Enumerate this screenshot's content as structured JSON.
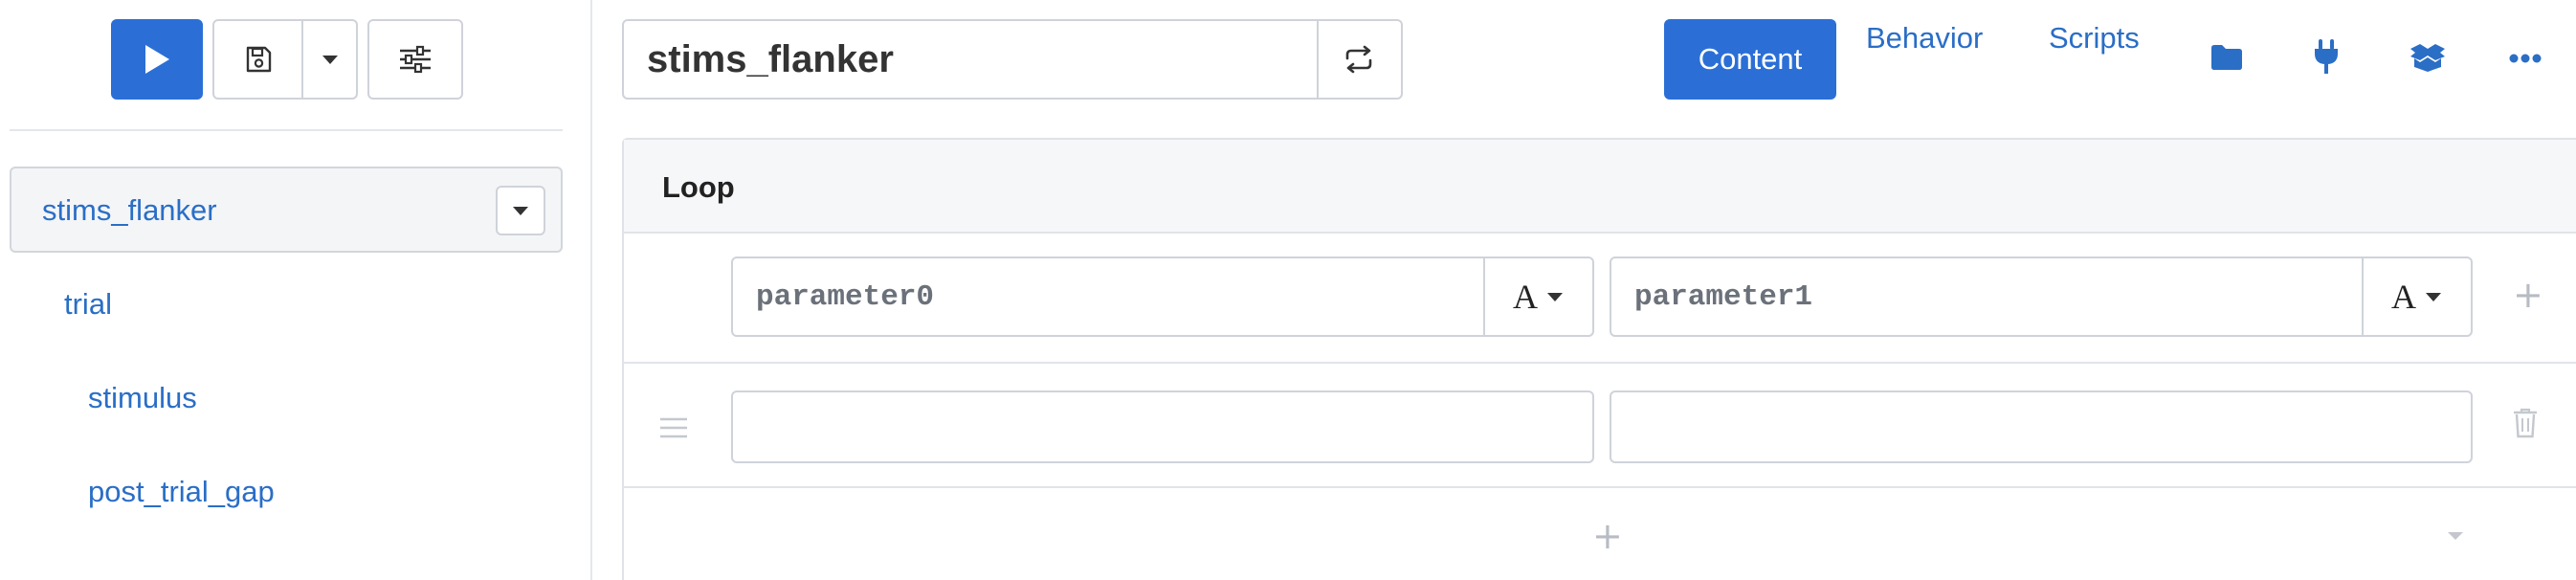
{
  "sidebar": {
    "toolbar": {
      "run_icon": "play-icon",
      "save_icon": "save-icon",
      "save_menu_icon": "chevron-down-icon",
      "options_icon": "sliders-icon"
    },
    "tree": {
      "root_label": "stims_flanker",
      "items": [
        {
          "label": "trial",
          "level": 1
        },
        {
          "label": "stimulus",
          "level": 2
        },
        {
          "label": "post_trial_gap",
          "level": 2
        }
      ]
    }
  },
  "editor": {
    "component_name": "stims_flanker",
    "sync_icon": "repeat-icon",
    "tabs": [
      {
        "label": "Content",
        "active": true
      },
      {
        "label": "Behavior",
        "active": false
      },
      {
        "label": "Scripts",
        "active": false
      }
    ],
    "tab_icons": [
      "folder-icon",
      "plug-icon",
      "box-open-icon",
      "ellipsis-icon"
    ],
    "loop": {
      "title": "Loop",
      "columns": [
        {
          "name": "parameter0",
          "type": "A"
        },
        {
          "name": "parameter1",
          "type": "A"
        }
      ],
      "rows": [
        {
          "cells": [
            "",
            ""
          ]
        }
      ],
      "add_column_symbol": "+",
      "add_row_symbol": "+"
    }
  },
  "colors": {
    "accent": "#2b6fd6",
    "link": "#2a6ec6",
    "border": "#cfd3d9",
    "muted_icon": "#b7bcc3"
  }
}
